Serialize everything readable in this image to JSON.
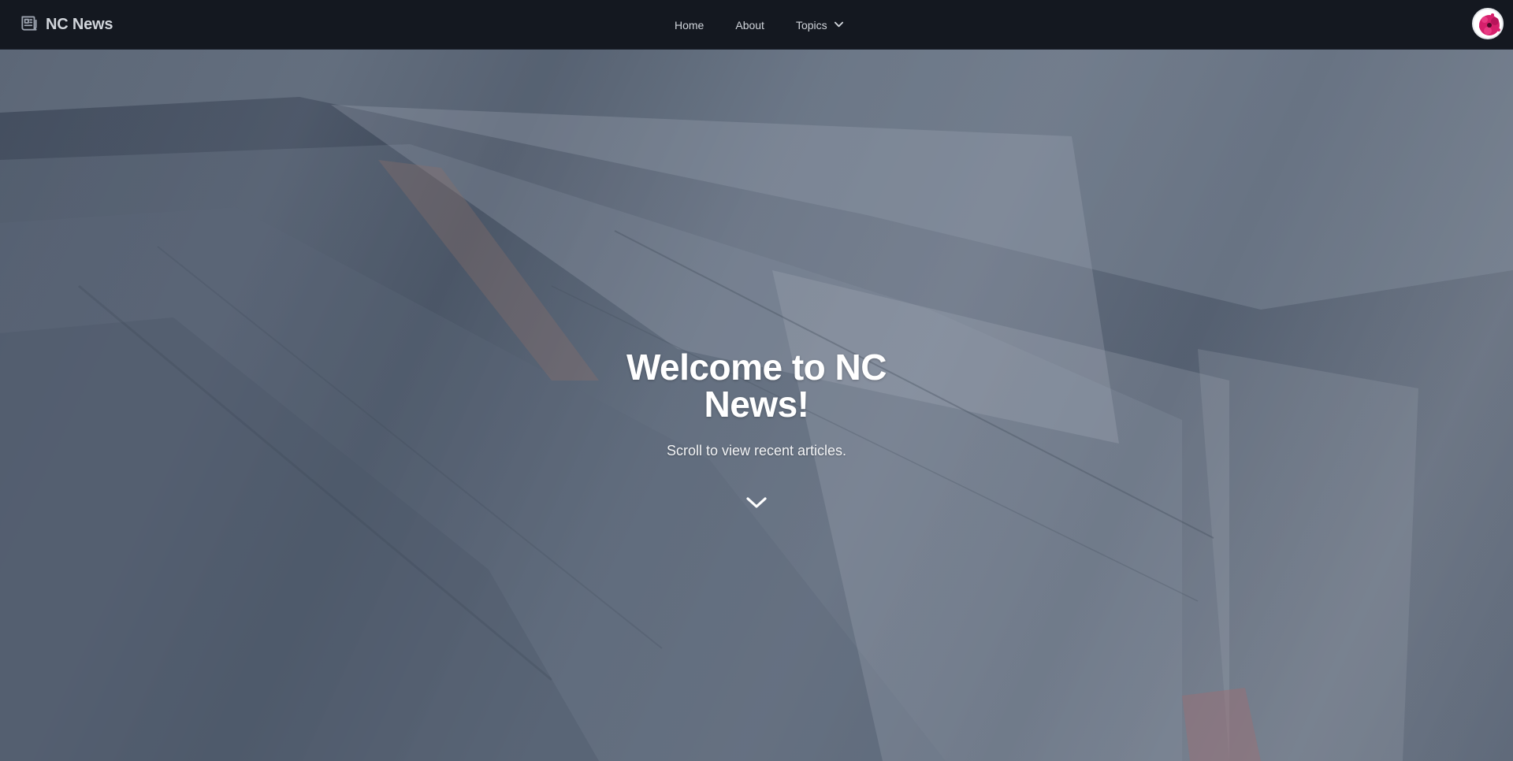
{
  "navbar": {
    "brand": {
      "icon": "newspaper-icon",
      "label": "NC News"
    },
    "links": [
      {
        "label": "Home"
      },
      {
        "label": "About"
      }
    ],
    "topics": {
      "label": "Topics",
      "icon": "chevron-down-icon"
    },
    "avatar": {
      "icon": "user-avatar"
    }
  },
  "hero": {
    "background": "newspapers-photo",
    "title": "Welcome to NC News!",
    "subtitle": "Scroll to view recent articles.",
    "scroll_icon": "chevron-down-icon"
  },
  "colors": {
    "nav_bg": "#141820",
    "nav_text": "#d1d5db",
    "hero_overlay": "#263042",
    "avatar_accent": "#d61f6b"
  }
}
